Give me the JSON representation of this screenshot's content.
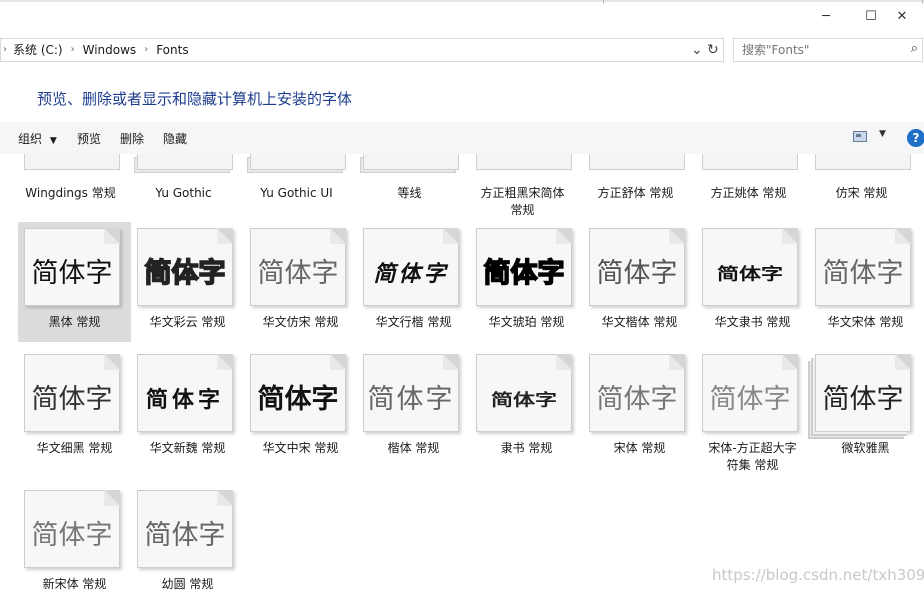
{
  "window": {
    "controls": {
      "minimize": "─",
      "maximize": "☐",
      "close": "✕"
    }
  },
  "address": {
    "crumbs": [
      "系统 (C:)",
      "Windows",
      "Fonts"
    ],
    "separator": "›",
    "dropdown_glyph": "⌄",
    "refresh_glyph": "↻",
    "search_placeholder": "搜索\"Fonts\"",
    "search_icon": "⌕"
  },
  "heading": "预览、删除或者显示和隐藏计算机上安装的字体",
  "toolbar": {
    "organize": "组织",
    "organize_caret": "▼",
    "preview": "预览",
    "delete": "删除",
    "hide": "隐藏",
    "view_caret": "▼",
    "help": "?"
  },
  "partial_row": [
    {
      "label": "Wingdings 常规",
      "icon": "single-page-icon",
      "sample": ""
    },
    {
      "label": "Yu Gothic",
      "icon": "stacked-pages-icon",
      "sample": ""
    },
    {
      "label": "Yu Gothic UI",
      "icon": "stacked-pages-icon",
      "sample": ""
    },
    {
      "label": "等线",
      "icon": "stacked-pages-icon",
      "sample": ""
    },
    {
      "label": "方正粗黑宋简体\n常规",
      "icon": "single-page-icon",
      "sample": ""
    },
    {
      "label": "方正舒体 常规",
      "icon": "single-page-icon",
      "sample": ""
    },
    {
      "label": "方正姚体 常规",
      "icon": "single-page-icon",
      "sample": ""
    },
    {
      "label": "仿宋 常规",
      "icon": "single-page-icon",
      "sample": ""
    }
  ],
  "fonts": [
    {
      "label": "黑体 常规",
      "sample": "简体字",
      "style": "hei",
      "selected": true,
      "stacked": false
    },
    {
      "label": "华文彩云 常规",
      "sample": "简体字",
      "style": "caiyun",
      "selected": false,
      "stacked": false
    },
    {
      "label": "华文仿宋 常规",
      "sample": "简体字",
      "style": "fangsong",
      "selected": false,
      "stacked": false
    },
    {
      "label": "华文行楷 常规",
      "sample": "简体字",
      "style": "xingkai",
      "selected": false,
      "stacked": false
    },
    {
      "label": "华文琥珀 常规",
      "sample": "简体字",
      "style": "hupo",
      "selected": false,
      "stacked": false
    },
    {
      "label": "华文楷体 常规",
      "sample": "简体字",
      "style": "kaiti",
      "selected": false,
      "stacked": false
    },
    {
      "label": "华文隶书 常规",
      "sample": "简体字",
      "style": "lishu",
      "selected": false,
      "stacked": false
    },
    {
      "label": "华文宋体 常规",
      "sample": "简体字",
      "style": "songti",
      "selected": false,
      "stacked": false
    },
    {
      "label": "华文细黑 常规",
      "sample": "简体字",
      "style": "xihei",
      "selected": false,
      "stacked": false
    },
    {
      "label": "华文新魏 常规",
      "sample": "简体字",
      "style": "xinwei",
      "selected": false,
      "stacked": false
    },
    {
      "label": "华文中宋 常规",
      "sample": "简体字",
      "style": "zhongsong",
      "selected": false,
      "stacked": false
    },
    {
      "label": "楷体 常规",
      "sample": "简体字",
      "style": "kai",
      "selected": false,
      "stacked": false
    },
    {
      "label": "隶书 常规",
      "sample": "简体字",
      "style": "lishu2",
      "selected": false,
      "stacked": false
    },
    {
      "label": "宋体 常规",
      "sample": "简体字",
      "style": "song",
      "selected": false,
      "stacked": false
    },
    {
      "label": "宋体-方正超大字\n符集 常规",
      "sample": "简体字",
      "style": "chaoda",
      "selected": false,
      "stacked": false
    },
    {
      "label": "微软雅黑",
      "sample": "简体字",
      "style": "yahei",
      "selected": false,
      "stacked": true
    },
    {
      "label": "新宋体 常规",
      "sample": "简体字",
      "style": "xinsong",
      "selected": false,
      "stacked": false
    },
    {
      "label": "幼圆 常规",
      "sample": "简体字",
      "style": "youyuan",
      "selected": false,
      "stacked": false
    }
  ],
  "watermark": "https://blog.csdn.net/txh3093",
  "colors": {
    "heading": "#1e3d8f",
    "selection": "#dcdcdc",
    "toolbar_bg": "#f5f6f7",
    "help": "#1e6fc8"
  }
}
